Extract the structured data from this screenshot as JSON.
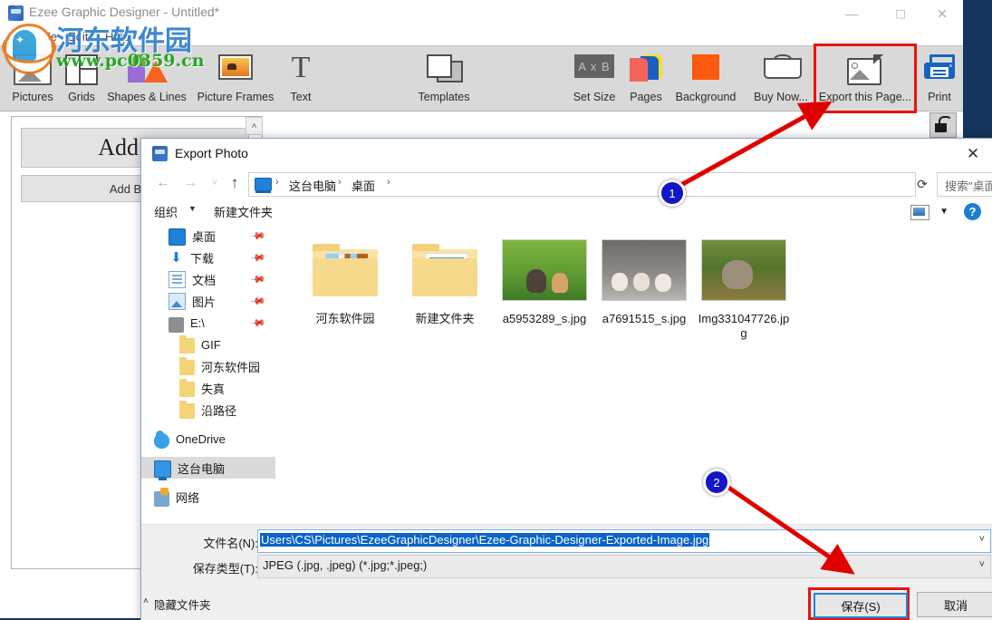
{
  "app": {
    "title": "Ezee Graphic Designer - Untitled*",
    "icon": "app-logo-icon",
    "window_controls": {
      "minimize": "—",
      "maximize": "☐",
      "close": "✕"
    },
    "menu": [
      {
        "label": "File"
      },
      {
        "label": "Edit"
      },
      {
        "label": "Help"
      }
    ],
    "toolbar": [
      {
        "label": "Pictures",
        "icon": "picture-icon"
      },
      {
        "label": "Grids",
        "icon": "grid-icon"
      },
      {
        "label": "Shapes & Lines",
        "icon": "shapes-icon"
      },
      {
        "label": "Picture Frames",
        "icon": "picture-frame-icon"
      },
      {
        "label": "Text",
        "icon": "text-icon"
      },
      {
        "label": "Templates",
        "icon": "templates-icon"
      },
      {
        "label": "Set Size",
        "icon": "set-size-icon"
      },
      {
        "label": "Pages",
        "icon": "pages-icon"
      },
      {
        "label": "Background",
        "icon": "background-icon"
      },
      {
        "label": "Buy Now...",
        "icon": "shopping-bag-icon"
      },
      {
        "label": "Export this Page...",
        "icon": "export-image-icon"
      },
      {
        "label": "Print",
        "icon": "printer-icon"
      }
    ],
    "canvas": {
      "add_header": "Add He",
      "add_body": "Add Body",
      "scroll_up": "˄",
      "lock": "unlock-icon"
    },
    "highlight_color": "#e8140f"
  },
  "dialog": {
    "title": "Export Photo",
    "icon": "app-logo-icon",
    "close": "✕",
    "nav": {
      "back": "←",
      "forward": "→",
      "recent": "˅",
      "up": "↑",
      "breadcrumb": [
        "这台电脑",
        "桌面"
      ],
      "separator": "›",
      "dropdown": "˅",
      "refresh": "⟳"
    },
    "search": {
      "placeholder": "搜索\"桌面\"",
      "icon": "search-icon"
    },
    "commands": {
      "organize": "组织",
      "organize_caret": "▼",
      "new_folder": "新建文件夹",
      "view_icon": "view-layout-icon",
      "view_caret": "▼",
      "help": "?"
    },
    "sidebar": {
      "items": [
        {
          "label": "桌面",
          "icon": "desktop-icon",
          "pinned": true,
          "level": 1
        },
        {
          "label": "下载",
          "icon": "downloads-icon",
          "pinned": true,
          "level": 1
        },
        {
          "label": "文档",
          "icon": "documents-icon",
          "pinned": true,
          "level": 1
        },
        {
          "label": "图片",
          "icon": "pictures-icon",
          "pinned": true,
          "level": 1
        },
        {
          "label": "E:\\",
          "icon": "drive-icon",
          "pinned": true,
          "level": 1
        },
        {
          "label": "GIF",
          "icon": "folder-icon",
          "pinned": false,
          "level": 2
        },
        {
          "label": "河东软件园",
          "icon": "folder-icon",
          "pinned": false,
          "level": 2
        },
        {
          "label": "失真",
          "icon": "folder-icon",
          "pinned": false,
          "level": 2
        },
        {
          "label": "沿路径",
          "icon": "folder-icon",
          "pinned": false,
          "level": 2
        },
        {
          "label": "OneDrive",
          "icon": "onedrive-icon",
          "pinned": false,
          "level": 0
        },
        {
          "label": "这台电脑",
          "icon": "this-pc-icon",
          "pinned": false,
          "level": 0,
          "selected": true
        },
        {
          "label": "网络",
          "icon": "network-icon",
          "pinned": false,
          "level": 0
        }
      ],
      "scroll_up": "˄",
      "scroll_down": "˅"
    },
    "files": [
      {
        "name": "河东软件园",
        "type": "folder",
        "thumb": "folder-books-thumb"
      },
      {
        "name": "新建文件夹",
        "type": "folder",
        "thumb": "folder-lines-thumb"
      },
      {
        "name": "a5953289_s.jpg",
        "type": "image",
        "thumb": "cats-photo-thumb"
      },
      {
        "name": "a7691515_s.jpg",
        "type": "image",
        "thumb": "puppies-photo-thumb"
      },
      {
        "name": "Img331047726.jpg",
        "type": "image",
        "thumb": "squirrel-photo-thumb"
      }
    ],
    "footer": {
      "filename_label": "文件名(N):",
      "filename_value": "Users\\CS\\Pictures\\EzeeGraphicDesigner\\Ezee-Graphic-Designer-Exported-Image.jpg",
      "filename_caret": "˅",
      "savetype_label": "保存类型(T):",
      "savetype_value": "JPEG (.jpg, .jpeg) (*.jpg;*.jpeg;)",
      "savetype_caret": "˅",
      "hide_folders": "隐藏文件夹",
      "hide_folders_caret": "˄",
      "save_button": "保存(S)",
      "cancel_button": "取消"
    }
  },
  "annotations": {
    "badges": [
      {
        "label": "1"
      },
      {
        "label": "2"
      }
    ],
    "arrow_color": "#e10000",
    "badge_color": "#1414c8"
  },
  "watermark": {
    "site_name": "河东软件园",
    "url": "www.pc0359.cn",
    "star": "✦"
  }
}
